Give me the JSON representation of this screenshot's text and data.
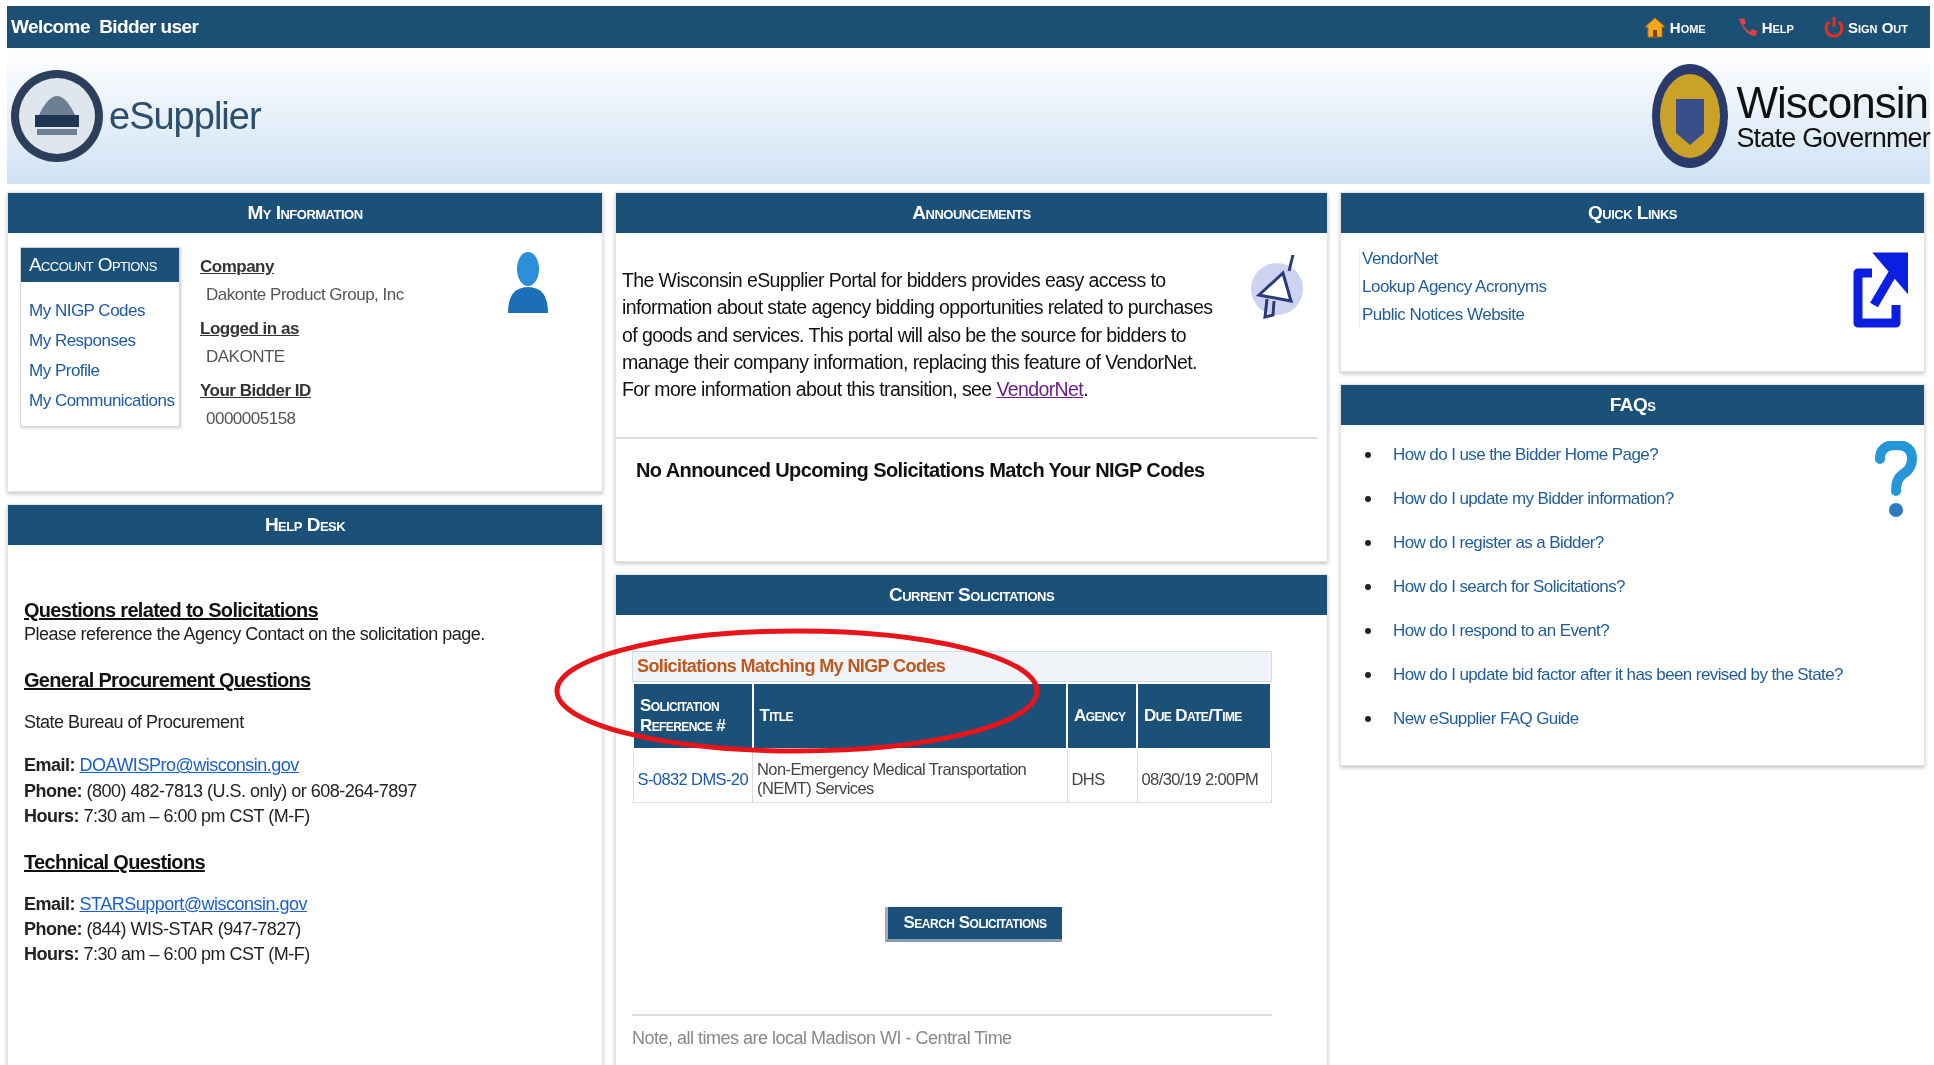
{
  "top_bar": {
    "welcome": "Welcome  Bidder user",
    "links": [
      {
        "label": "Home",
        "kind": "home"
      },
      {
        "label": "Help",
        "kind": "help"
      },
      {
        "label": "Sign Out",
        "kind": "signout"
      }
    ]
  },
  "header": {
    "logo_text": "eSupplier",
    "state_title": "Wisconsin",
    "state_subtitle": "State Governmer"
  },
  "my_information": {
    "title": "My Information",
    "account_options": {
      "title": "Account Options",
      "items": [
        "My NIGP Codes",
        "My Responses",
        "My Profile",
        "My Communications"
      ]
    },
    "fields": [
      {
        "label": "Company",
        "value": "Dakonte Product Group, Inc"
      },
      {
        "label": "Logged in as",
        "value": "DAKONTE"
      },
      {
        "label": "Your Bidder ID",
        "value": "0000005158"
      }
    ]
  },
  "help_desk": {
    "title": "Help Desk",
    "sections": [
      {
        "heading": "Questions related to Solicitations",
        "lines": [
          {
            "kind": "text",
            "value": "Please reference the Agency Contact on the solicitation page."
          }
        ]
      },
      {
        "heading": "General Procurement Questions",
        "lines": [
          {
            "kind": "text",
            "value": "State Bureau of Procurement"
          },
          {
            "kind": "email",
            "label": "Email:",
            "value": "DOAWISPro@wisconsin.gov"
          },
          {
            "kind": "labeled",
            "label": "Phone:",
            "value": "(800) 482-7813 (U.S. only) or 608-264-7897"
          },
          {
            "kind": "labeled",
            "label": "Hours:",
            "value": "7:30 am – 6:00 pm CST (M-F)"
          }
        ]
      },
      {
        "heading": "Technical Questions",
        "lines": [
          {
            "kind": "email",
            "label": "Email:",
            "value": "STARSupport@wisconsin.gov"
          },
          {
            "kind": "labeled",
            "label": "Phone:",
            "value": "(844) WIS-STAR (947-7827)"
          },
          {
            "kind": "labeled",
            "label": "Hours:",
            "value": "7:30 am – 6:00 pm CST (M-F)"
          }
        ]
      }
    ]
  },
  "announcements": {
    "title": "Announcements",
    "body": "The Wisconsin eSupplier Portal for bidders provides easy access to information about state agency bidding opportunities related to purchases of goods and services. This portal will also be the source for bidders to manage their company information, replacing this feature of VendorNet. For more information about this transition, see ",
    "link": "VendorNet",
    "body_end": ".",
    "notice": "No Announced Upcoming Solicitations Match Your NIGP Codes"
  },
  "current_solicitations": {
    "title": "Current Solicitations",
    "table": {
      "caption": "Solicitations Matching My NIGP Codes",
      "columns": [
        "Solicitation Reference #",
        "Title",
        "Agency",
        "Due Date/Time"
      ],
      "rows": [
        {
          "cells": [
            "S-0832 DMS-20",
            "Non-Emergency Medical Transportation (NEMT) Services",
            "DHS",
            "08/30/19  2:00PM"
          ]
        }
      ]
    },
    "button": "Search Solicitations",
    "note": "Note, all times are local Madison WI - Central Time",
    "highlight_caption": true
  },
  "quick_links": {
    "title": "Quick Links",
    "links": [
      "VendorNet",
      "Lookup Agency Acronyms",
      "Public Notices Website"
    ]
  },
  "faqs": {
    "title": "FAQs",
    "items": [
      "How do I use the Bidder Home Page?",
      "How do I update my Bidder information?",
      "How do I register as a Bidder?",
      "How do I search for Solicitations?",
      "How do I respond to an Event?",
      "How do I update bid factor after it has been revised by the State?",
      "New eSupplier FAQ Guide"
    ]
  }
}
